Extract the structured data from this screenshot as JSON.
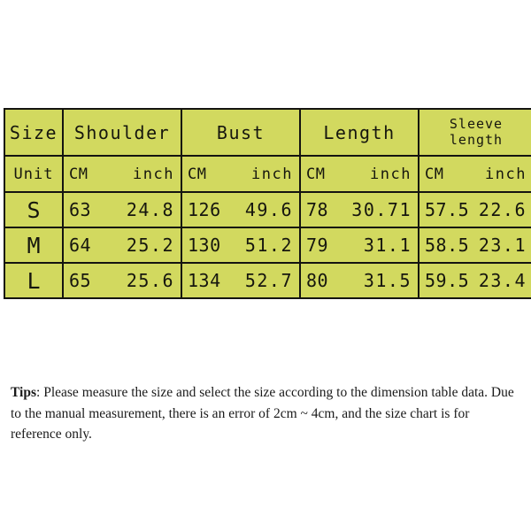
{
  "table": {
    "header": {
      "size_label": "Size",
      "groups": [
        {
          "label": "Shoulder",
          "two_line": false
        },
        {
          "label": "Bust",
          "two_line": false
        },
        {
          "label": "Length",
          "two_line": false
        },
        {
          "label": "Sleeve length",
          "line1": "Sleeve",
          "line2": "length",
          "two_line": true
        }
      ]
    },
    "unit_row": {
      "row_label": "Unit",
      "cm": "CM",
      "inch": "inch"
    },
    "rows": [
      {
        "size": "S",
        "shoulder_cm": "63",
        "shoulder_inch": "24.8",
        "bust_cm": "126",
        "bust_inch": "49.6",
        "length_cm": "78",
        "length_inch": "30.71",
        "sleeve_cm": "57.5",
        "sleeve_inch": "22.6"
      },
      {
        "size": "M",
        "shoulder_cm": "64",
        "shoulder_inch": "25.2",
        "bust_cm": "130",
        "bust_inch": "51.2",
        "length_cm": "79",
        "length_inch": "31.1",
        "sleeve_cm": "58.5",
        "sleeve_inch": "23.1"
      },
      {
        "size": "L",
        "shoulder_cm": "65",
        "shoulder_inch": "25.6",
        "bust_cm": "134",
        "bust_inch": "52.7",
        "length_cm": "80",
        "length_inch": "31.5",
        "sleeve_cm": "59.5",
        "sleeve_inch": "23.4"
      }
    ],
    "colors": {
      "cell_background": "#d2d95f",
      "border": "#141410",
      "text": "#16160e"
    }
  },
  "tips": {
    "label": "Tips",
    "separator": ": ",
    "body": "Please measure the size and select the size according to the dimension table data. Due to the manual measurement, there is an error of 2cm ~ 4cm, and the size chart is for reference only."
  }
}
